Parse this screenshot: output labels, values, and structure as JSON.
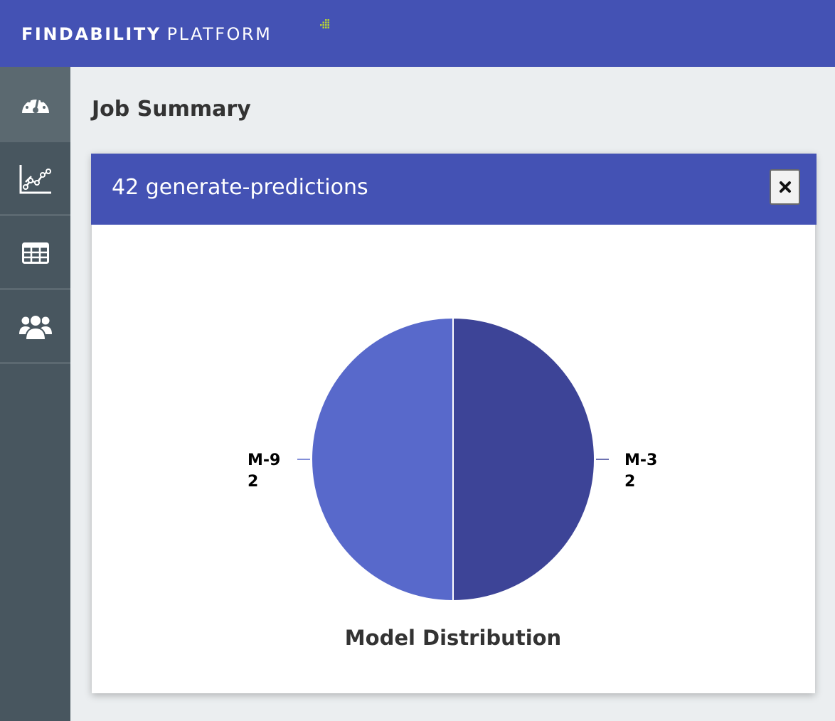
{
  "app": {
    "logo_bold": "FINDABILITY",
    "logo_light": "PLATFORM",
    "brand_color": "#4452b4",
    "logo_accent_color": "#b5d334"
  },
  "sidebar": {
    "items": [
      {
        "icon": "dashboard-gauge-icon",
        "active": true
      },
      {
        "icon": "line-chart-icon",
        "active": false
      },
      {
        "icon": "table-icon",
        "active": false
      },
      {
        "icon": "users-icon",
        "active": false
      }
    ]
  },
  "page": {
    "title": "Job Summary"
  },
  "card": {
    "title": "42 generate-predictions",
    "close_icon": "close-icon"
  },
  "chart_data": {
    "type": "pie",
    "title": "Model Distribution",
    "slices": [
      {
        "label": "M-3",
        "value": 2,
        "color": "#3d4497"
      },
      {
        "label": "M-9",
        "value": 2,
        "color": "#5869cb"
      }
    ]
  }
}
